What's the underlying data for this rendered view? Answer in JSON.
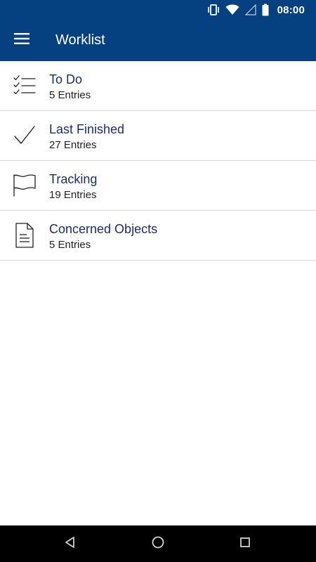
{
  "status_bar": {
    "time": "08:00",
    "icons": [
      "vibrate-icon",
      "wifi-icon",
      "signal-icon",
      "battery-icon"
    ]
  },
  "app_bar": {
    "title": "Worklist",
    "menu_icon": "hamburger-menu-icon"
  },
  "worklist": {
    "items": [
      {
        "title": "To Do",
        "subtitle": "5 Entries",
        "icon": "checklist-icon"
      },
      {
        "title": "Last Finished",
        "subtitle": "27 Entries",
        "icon": "checkmark-icon"
      },
      {
        "title": "Tracking",
        "subtitle": "19 Entries",
        "icon": "flag-icon"
      },
      {
        "title": "Concerned Objects",
        "subtitle": "5 Entries",
        "icon": "document-icon"
      }
    ]
  },
  "nav_bar": {
    "buttons": [
      "back-icon",
      "home-icon",
      "recents-icon"
    ]
  },
  "colors": {
    "primary": "#054080",
    "item_title": "#1c2d6e",
    "divider": "#d9d9d9"
  }
}
